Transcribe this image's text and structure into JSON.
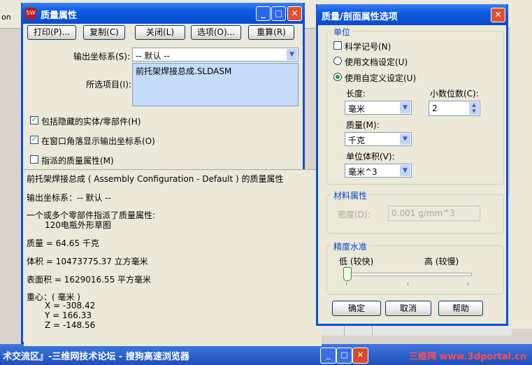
{
  "background": {
    "top_left_fragment": "on",
    "taskbar_text": "术交流区』-三维网技术论坛 - 搜狗高速浏览器",
    "watermark": "三维网 www.3dportal.cn"
  },
  "mass_window": {
    "title": "质量属性",
    "buttons": {
      "print": "打印(P)...",
      "copy": "复制(C)",
      "close": "关闭(L)",
      "options": "选项(O)...",
      "recalc": "重算(R)"
    },
    "output_coord_label": "输出坐标系(S):",
    "output_coord_value": "-- 默认 --",
    "selected_items_label": "所选项目(I):",
    "selected_items_value": "前托架焊接总成.SLDASM",
    "checkboxes": {
      "include_hidden": "包括隐藏的实体/零部件(H)",
      "show_coord_corner": "在窗口角落显示输出坐标系(O)",
      "assigned_mass": "指派的质量属性(M)"
    },
    "results": [
      "前托架焊接总成 ( Assembly Configuration - Default ) 的质量属性",
      "输出坐标系：-- 默认 --",
      "一个或多个零部件指派了质量属性:",
      "120电瓶外形草图",
      "质量 = 64.65 千克",
      "体积 = 10473775.37  立方毫米",
      "表面积 = 1629016.55  平方毫米",
      "重心：( 毫米 )",
      "X = -308.42",
      "Y = 166.33",
      "Z = -148.56"
    ]
  },
  "options_window": {
    "title": "质量/剖面属性选项",
    "units_group": "单位",
    "sci_notation": "科学记号(N)",
    "use_doc": "使用文档设定(U)",
    "use_custom": "使用自定义设定(U)",
    "length_label": "长度:",
    "length_value": "毫米",
    "decimals_label": "小数位数(C):",
    "decimals_value": "2",
    "mass_label": "质量(M):",
    "mass_value": "千克",
    "volume_label": "单位体积(V):",
    "volume_value": "毫米^3",
    "material_group": "材料属性",
    "density_label": "密度(D):",
    "density_value": "0.001 g/mm^3",
    "accuracy_group": "精度水准",
    "low_label": "低 (较快)",
    "high_label": "高 (较慢)",
    "accuracy_level": 0.0,
    "ok": "确定",
    "cancel": "取消",
    "help": "帮助"
  }
}
